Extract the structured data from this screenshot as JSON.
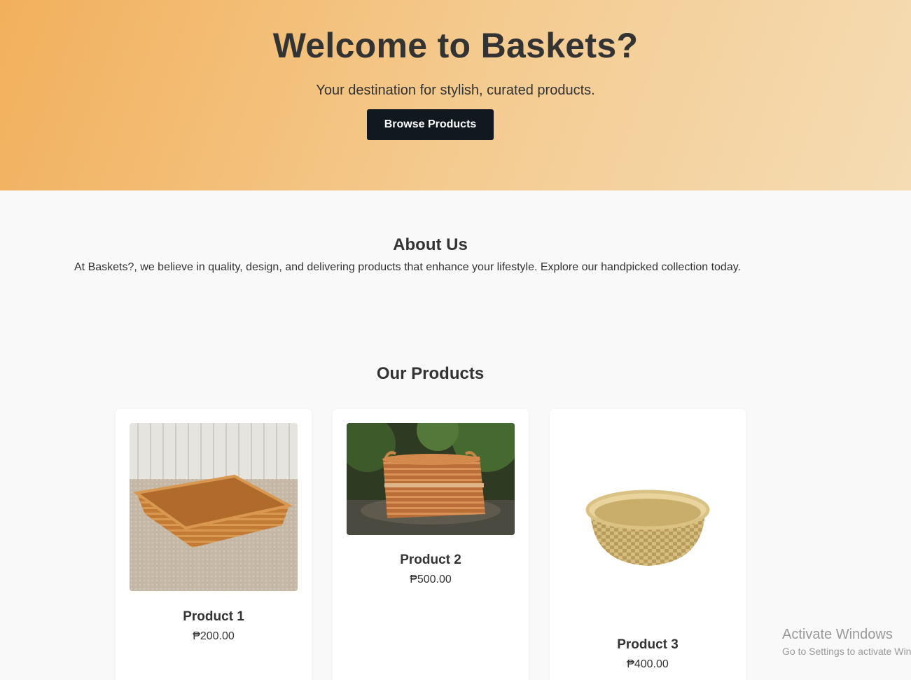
{
  "hero": {
    "title": "Welcome to Baskets?",
    "subtitle": "Your destination for stylish, curated products.",
    "button_label": "Browse Products"
  },
  "about": {
    "title": "About Us",
    "text": "At Baskets?, we believe in quality, design, and delivering products that enhance your lifestyle. Explore our handpicked collection today."
  },
  "products": {
    "title": "Our Products",
    "items": [
      {
        "name": "Product 1",
        "price": "₱200.00",
        "image": "wicker-rectangular-basket"
      },
      {
        "name": "Product 2",
        "price": "₱500.00",
        "image": "wicker-basket-with-handles-outdoors"
      },
      {
        "name": "Product 3",
        "price": "₱400.00",
        "image": "bamboo-round-bowl-basket"
      }
    ]
  },
  "watermark": {
    "line1": "Activate Windows",
    "line2": "Go to Settings to activate Windows."
  },
  "colors": {
    "hero_gradient_start": "#f2b05c",
    "hero_gradient_end": "#f5dcb4",
    "button_bg": "#111820",
    "page_bg": "#f9f9f9"
  }
}
